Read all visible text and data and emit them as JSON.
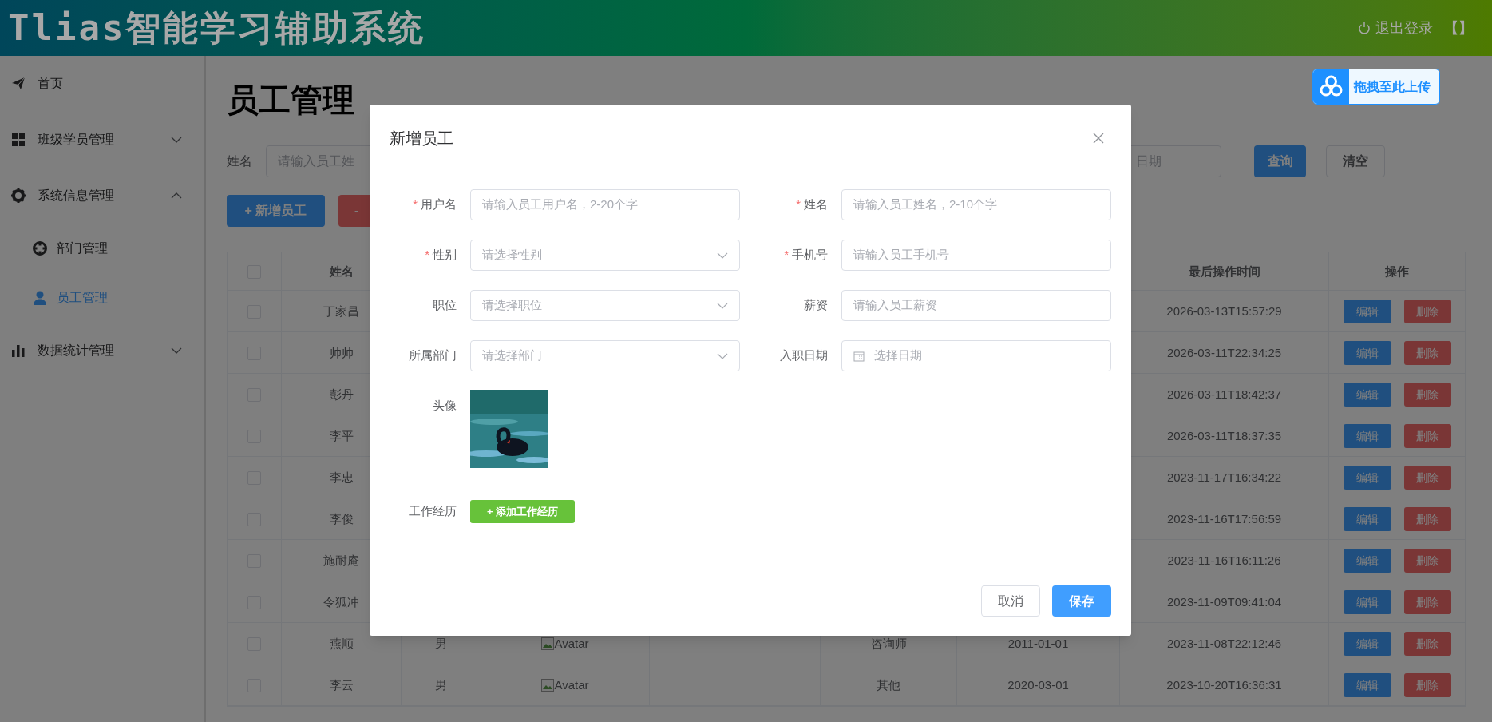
{
  "header": {
    "title": "Tlias智能学习辅助系统",
    "logout": "退出登录",
    "bracket": "【】"
  },
  "upload_widget": {
    "label": "拖拽至此上传"
  },
  "sidebar": {
    "items": [
      {
        "kind": "link",
        "label": "首页",
        "selected": false
      },
      {
        "kind": "group",
        "label": "班级学员管理",
        "expanded": false,
        "selected": false
      },
      {
        "kind": "group",
        "label": "系统信息管理",
        "expanded": true,
        "selected": false,
        "children": [
          {
            "label": "部门管理",
            "selected": false
          },
          {
            "label": "员工管理",
            "selected": true
          }
        ]
      },
      {
        "kind": "group",
        "label": "数据统计管理",
        "expanded": false,
        "selected": false
      }
    ]
  },
  "page": {
    "title": "员工管理",
    "search": {
      "name_label": "姓名",
      "name_placeholder": "请输入员工姓",
      "date_placeholder": "日期",
      "query": "查询",
      "clear": "清空"
    },
    "actions": {
      "add": "+ 新增员工",
      "batch_delete": "-"
    }
  },
  "table": {
    "header": {
      "checked": false,
      "name": "姓名",
      "last_operated": "最后操作时间",
      "actions": "操作"
    },
    "rows": [
      {
        "checked": false,
        "name": "丁家昌",
        "last_operated": "2026-03-13T15:57:29",
        "edit": "编辑",
        "delete": "删除"
      },
      {
        "checked": false,
        "name": "帅帅",
        "last_operated": "2026-03-11T22:34:25",
        "edit": "编辑",
        "delete": "删除"
      },
      {
        "checked": false,
        "name": "彭丹",
        "last_operated": "2026-03-11T18:42:37",
        "edit": "编辑",
        "delete": "删除"
      },
      {
        "checked": false,
        "name": "李平",
        "last_operated": "2026-03-11T18:37:35",
        "edit": "编辑",
        "delete": "删除"
      },
      {
        "checked": false,
        "name": "李忠",
        "last_operated": "2023-11-17T16:34:22",
        "edit": "编辑",
        "delete": "删除"
      },
      {
        "checked": false,
        "name": "李俊",
        "last_operated": "2023-11-16T17:56:59",
        "edit": "编辑",
        "delete": "删除"
      },
      {
        "checked": false,
        "name": "施耐庵",
        "last_operated": "2023-11-16T16:11:26",
        "edit": "编辑",
        "delete": "删除"
      },
      {
        "checked": false,
        "name": "令狐冲",
        "last_operated": "2023-11-09T09:41:04",
        "edit": "编辑",
        "delete": "删除"
      },
      {
        "checked": false,
        "name": "燕顺",
        "gender": "男",
        "avatar": "Avatar",
        "position": "咨询师",
        "entry_date": "2011-01-01",
        "last_operated": "2023-11-08T22:12:46",
        "edit": "编辑",
        "delete": "删除"
      },
      {
        "checked": false,
        "name": "李云",
        "gender": "男",
        "avatar": "Avatar",
        "position": "其他",
        "entry_date": "2020-03-01",
        "last_operated": "2023-10-20T16:36:31",
        "edit": "编辑",
        "delete": "删除"
      }
    ]
  },
  "dialog": {
    "title": "新增员工",
    "required_mark": "*",
    "fields": [
      {
        "label": "用户名",
        "required": true,
        "kind": "input",
        "placeholder": "请输入员工用户名，2-20个字"
      },
      {
        "label": "姓名",
        "required": true,
        "kind": "input",
        "placeholder": "请输入员工姓名，2-10个字"
      },
      {
        "label": "性别",
        "required": true,
        "kind": "select",
        "placeholder": "请选择性别"
      },
      {
        "label": "手机号",
        "required": true,
        "kind": "input",
        "placeholder": "请输入员工手机号"
      },
      {
        "label": "职位",
        "required": false,
        "kind": "select",
        "placeholder": "请选择职位"
      },
      {
        "label": "薪资",
        "required": false,
        "kind": "input",
        "placeholder": "请输入员工薪资"
      },
      {
        "label": "所属部门",
        "required": false,
        "kind": "select",
        "placeholder": "请选择部门"
      },
      {
        "label": "入职日期",
        "required": false,
        "kind": "date",
        "placeholder": "选择日期"
      }
    ],
    "avatar_label": "头像",
    "experience_label": "工作经历",
    "add_experience": "+ 添加工作经历",
    "cancel": "取消",
    "save": "保存"
  }
}
